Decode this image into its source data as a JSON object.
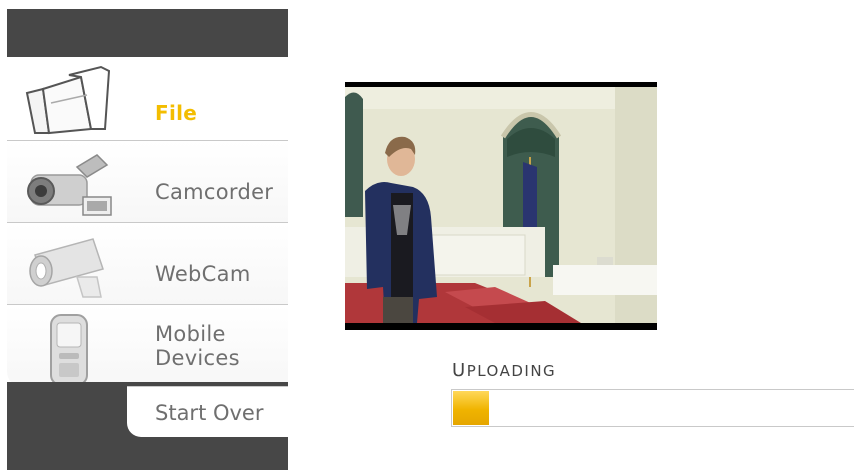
{
  "sources": {
    "items": [
      {
        "label": "File",
        "icon": "folder-icon",
        "active": true
      },
      {
        "label": "Camcorder",
        "icon": "camcorder-icon",
        "active": false
      },
      {
        "label": "WebCam",
        "icon": "webcam-icon",
        "active": false
      },
      {
        "label_line1": "Mobile",
        "label_line2": "Devices",
        "icon": "mobile-phone-icon",
        "active": false
      }
    ],
    "start_over_label": "Start Over"
  },
  "upload": {
    "status_first": "U",
    "status_rest": "PLOADING",
    "progress_fraction": 0.09
  },
  "colors": {
    "accent": "#f3bd00",
    "panel": "#474747",
    "label": "#6f6f6f"
  }
}
